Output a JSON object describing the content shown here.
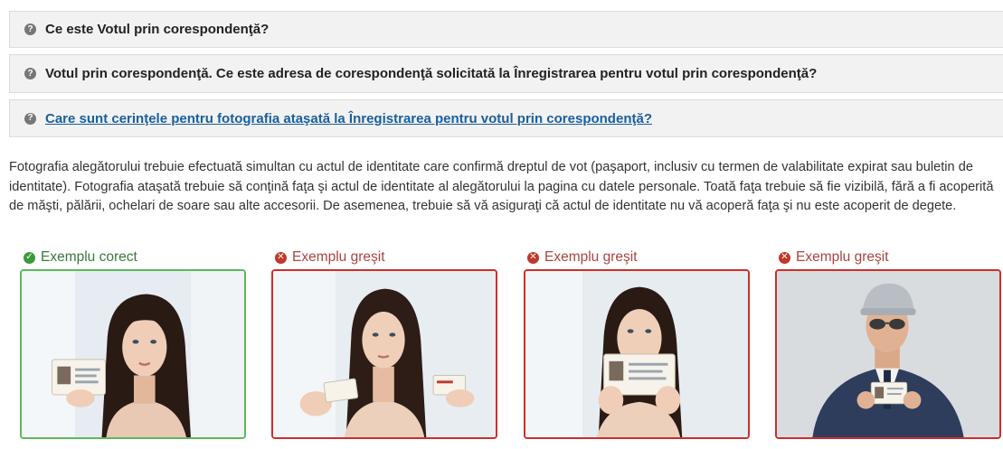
{
  "accordion": [
    {
      "title": "Ce este Votul prin corespondenţă?"
    },
    {
      "title": "Votul prin corespondenţă. Ce este adresa de corespondenţă solicitată la Înregistrarea pentru votul prin corespondenţă?"
    },
    {
      "title": "Care sunt cerinţele pentru fotografia ataşată la Înregistrarea pentru votul prin corespondenţă?"
    }
  ],
  "panel_text": "Fotografia alegătorului trebuie efectuată simultan cu actul de identitate care confirmă dreptul de vot (paşaport, inclusiv cu termen de valabilitate expirat sau buletin de identitate). Fotografia ataşată trebuie să conţină faţa şi actul de identitate al alegătorului la pagina cu datele personale. Toată faţa trebuie să fie vizibilă, fără a fi acoperită de măşti, pălării, ochelari de soare sau alte accesorii. De asemenea, trebuie să vă asiguraţi că actul de identitate nu vă acoperă faţa şi nu este acoperit de degete.",
  "examples": [
    {
      "label": "Exemplu corect",
      "status": "correct"
    },
    {
      "label": "Exemplu greşit",
      "status": "wrong"
    },
    {
      "label": "Exemplu greşit",
      "status": "wrong"
    },
    {
      "label": "Exemplu greşit",
      "status": "wrong"
    }
  ],
  "colors": {
    "correct": "#3c763d",
    "wrong": "#a94442",
    "link": "#1a5f9c"
  },
  "icons": {
    "accordion": "question-circle-icon",
    "correct": "check-circle-icon",
    "wrong": "times-circle-icon"
  }
}
